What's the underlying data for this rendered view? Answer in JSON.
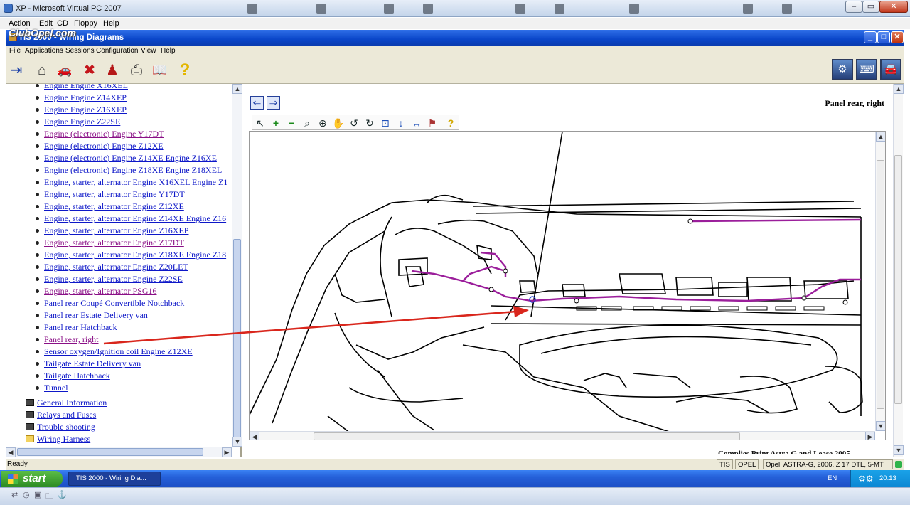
{
  "vpc_window": {
    "title": "XP - Microsoft Virtual PC 2007",
    "menu": [
      "Action",
      "Edit",
      "CD",
      "Floppy",
      "Help"
    ],
    "minimize_symbol": "–",
    "restore_symbol": "▭",
    "close_symbol": "✕"
  },
  "overlay_logo": "ClubOpel.com",
  "app": {
    "title": "TIS 2000 - Wiring Diagrams",
    "menu": [
      "File",
      "Applications",
      "Sessions",
      "Configuration",
      "View",
      "Help"
    ],
    "window_buttons": {
      "minimize": "_",
      "maximize": "□",
      "close": "✕"
    }
  },
  "toolbar_icons": [
    "exit-icon",
    "home-icon",
    "vehicle-select-icon",
    "stop-icon",
    "person-icon",
    "print-icon",
    "manual-icon",
    "help-icon"
  ],
  "toolbar_glyphs": {
    "exit": "⇥",
    "home": "⌂",
    "vehicle": "🚗",
    "stop": "✖",
    "person": "♟",
    "print": "⎙",
    "manual": "📖",
    "help": "?"
  },
  "toolbar_right_glyphs": {
    "repair": "⚙",
    "tech": "⌨",
    "car": "🚘"
  },
  "tree": {
    "items": [
      {
        "label": "Engine Engine X16XEL",
        "visited": false
      },
      {
        "label": "Engine Engine Z14XEP",
        "visited": false
      },
      {
        "label": "Engine Engine Z16XEP",
        "visited": false
      },
      {
        "label": "Engine Engine Z22SE",
        "visited": false
      },
      {
        "label": "Engine (electronic) Engine Y17DT",
        "visited": true
      },
      {
        "label": "Engine (electronic) Engine Z12XE",
        "visited": false
      },
      {
        "label": "Engine (electronic) Engine Z14XE Engine Z16XE",
        "visited": false
      },
      {
        "label": "Engine (electronic) Engine Z18XE Engine Z18XEL",
        "visited": false
      },
      {
        "label": "Engine, starter, alternator Engine X16XEL Engine Z1",
        "visited": false
      },
      {
        "label": "Engine, starter, alternator Engine Y17DT",
        "visited": false
      },
      {
        "label": "Engine, starter, alternator Engine Z12XE",
        "visited": false
      },
      {
        "label": "Engine, starter, alternator Engine Z14XE Engine Z16",
        "visited": false
      },
      {
        "label": "Engine, starter, alternator Engine Z16XEP",
        "visited": false
      },
      {
        "label": "Engine, starter, alternator Engine Z17DT",
        "visited": true
      },
      {
        "label": "Engine, starter, alternator Engine Z18XE Engine Z18",
        "visited": false
      },
      {
        "label": "Engine, starter, alternator Engine Z20LET",
        "visited": false
      },
      {
        "label": "Engine, starter, alternator Engine Z22SE",
        "visited": false
      },
      {
        "label": "Engine, starter, alternator PSG16",
        "visited": true
      },
      {
        "label": "Panel rear Coupé Convertible Notchback",
        "visited": false
      },
      {
        "label": "Panel rear Estate Delivery van",
        "visited": false
      },
      {
        "label": "Panel rear Hatchback",
        "visited": false
      },
      {
        "label": "Panel rear, right",
        "visited": true
      },
      {
        "label": "Sensor oxygen/Ignition coil Engine Z12XE",
        "visited": false
      },
      {
        "label": "Tailgate Estate Delivery van",
        "visited": false
      },
      {
        "label": "Tailgate Hatchback",
        "visited": false
      },
      {
        "label": "Tunnel",
        "visited": false
      }
    ],
    "top_level": [
      {
        "label": "General Information",
        "icon": "book-icon"
      },
      {
        "label": "Relays and Fuses",
        "icon": "book-icon"
      },
      {
        "label": "Trouble shooting",
        "icon": "book-icon"
      },
      {
        "label": "Wiring Harness",
        "icon": "folder-icon"
      }
    ]
  },
  "scroll_arrows": {
    "up": "▲",
    "down": "▼",
    "left": "◀",
    "right": "▶"
  },
  "diagram": {
    "title": "Panel rear, right",
    "nav_symbols": {
      "back": "⇐",
      "forward": "⇒"
    },
    "tool_glyphs": {
      "pointer": "↖",
      "zoom-in": "+",
      "zoom-out": "−",
      "zoom": "⌕",
      "zoom-area": "⊕",
      "pan": "✋",
      "rotate-left": "↺",
      "rotate-right": "↻",
      "fit-page": "⊡",
      "fit-height": "↕",
      "fit-width": "↔",
      "component-locate": "⚑",
      "help": "?"
    },
    "bottom_cutoff_text": "Complies Print Astra G and Lease 2005"
  },
  "colors": {
    "harness": "#9b1e9b",
    "arrow": "#d9261c",
    "link": "#0d17c8",
    "visited_link": "#8a0f86",
    "xp_blue": "#0a46c9"
  },
  "status_bar": {
    "text": "Ready",
    "panes": [
      "TIS",
      "OPEL",
      "Opel, ASTRA-G, 2006, Z 17 DTL, 5-MT"
    ]
  },
  "taskbar": {
    "start_label": "start",
    "task_label": "TIS 2000 - Wiring Dia...",
    "language": "EN",
    "clock": "20:13",
    "tray_glyph": "⚙⚙"
  },
  "host_bar_glyphs": [
    "⇄",
    "◷",
    "▣",
    "🗀",
    "⚓"
  ]
}
